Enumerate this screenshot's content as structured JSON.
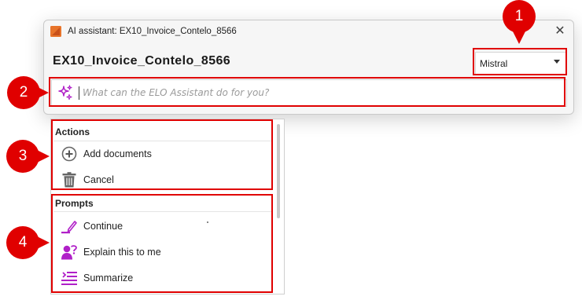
{
  "window": {
    "title": "AI assistant: EX10_Invoice_Contelo_8566",
    "close_symbol": "✕"
  },
  "document": {
    "name": "EX10_Invoice_Contelo_8566"
  },
  "model": {
    "selected": "Mistral"
  },
  "prompt": {
    "placeholder": "What can the ELO Assistant do for you?"
  },
  "menu": {
    "actions": {
      "heading": "Actions",
      "items": [
        {
          "label": "Add documents",
          "icon": "add-circle-icon"
        },
        {
          "label": "Cancel",
          "icon": "trash-icon"
        }
      ]
    },
    "prompts": {
      "heading": "Prompts",
      "items": [
        {
          "label": "Continue",
          "icon": "pen-icon"
        },
        {
          "label": "Explain this to me",
          "icon": "person-question-icon"
        },
        {
          "label": "Summarize",
          "icon": "summarize-lines-icon"
        }
      ]
    }
  },
  "callouts": [
    "1",
    "2",
    "3",
    "4"
  ],
  "colors": {
    "annotation_red": "#e00000",
    "prompt_purple": "#b020c8",
    "app_orange": "#e8742a"
  }
}
